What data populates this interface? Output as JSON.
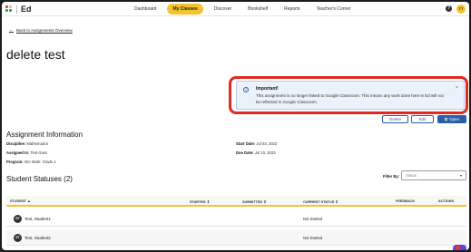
{
  "logo": {
    "text": "Ed"
  },
  "nav": {
    "items": [
      {
        "label": "Dashboard",
        "active": false
      },
      {
        "label": "My Classes",
        "active": true
      },
      {
        "label": "Discover",
        "active": false
      },
      {
        "label": "Bookshelf",
        "active": false
      },
      {
        "label": "Reports",
        "active": false
      },
      {
        "label": "Teacher's Corner",
        "active": false
      }
    ],
    "help_glyph": "?",
    "avatar_initials": "TT"
  },
  "back_link": "Back to Assignments Overview",
  "page_title": "delete test",
  "alert": {
    "title": "Important!",
    "body": "This assignment is no longer linked to Google Classroom. This means any work done here in Ed will not be reflected in Google Classroom.",
    "close_glyph": "×"
  },
  "actions": {
    "delete": "Delete",
    "edit": "Edit",
    "open": "Open"
  },
  "assignment_info": {
    "heading": "Assignment Information",
    "discipline_label": "Discipline:",
    "discipline": "Mathematics",
    "assigned_label": "Assigned to:",
    "assigned": "Test class",
    "program_label": "Program:",
    "program": "Into Math: Grade 1",
    "start_label": "Start Date:",
    "start": "Jul 03, 2023",
    "due_label": "Due Date:",
    "due": "Jul 10, 2023"
  },
  "student_statuses": {
    "heading": "Student Statuses (2)"
  },
  "filter": {
    "label": "Filter By:",
    "placeholder": "Status"
  },
  "table": {
    "columns": [
      "STUDENT",
      "STARTED",
      "SUBMITTED",
      "CURRENT STATUS",
      "FEEDBACK",
      "ACTIONS"
    ],
    "rows": [
      {
        "initials": "ST",
        "name": "Test, Student1",
        "status": "Not Started"
      },
      {
        "initials": "ST",
        "name": "Test, Student2",
        "status": "Not Started"
      }
    ]
  },
  "colors": {
    "accent": "#f5c32c",
    "primary": "#2a5ea8",
    "highlight": "#e02a20"
  }
}
